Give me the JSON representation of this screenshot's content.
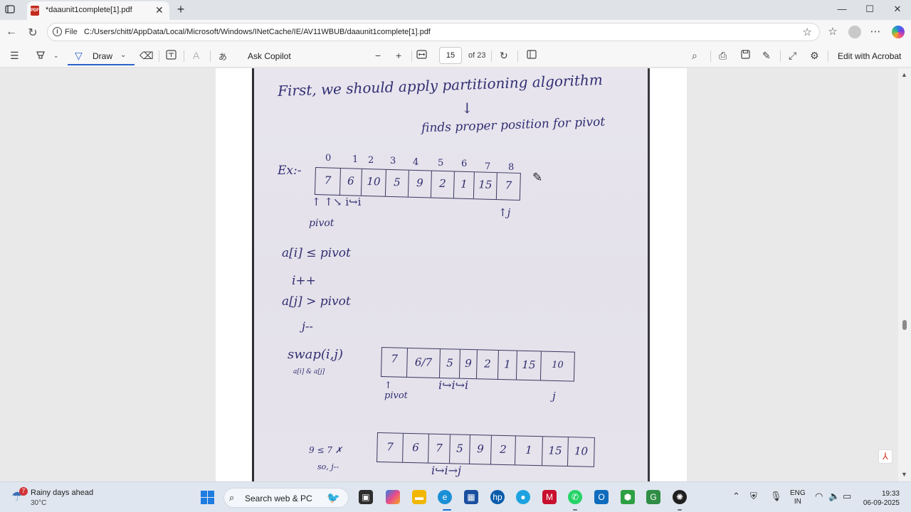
{
  "browser": {
    "tab_title": "*daaunit1complete[1].pdf",
    "new_tab": "+",
    "close_tab": "✕",
    "window_minimize": "—",
    "window_maximize": "☐",
    "window_close": "✕",
    "url_scheme_label": "File",
    "url_path": "C:/Users/chitt/AppData/Local/Microsoft/Windows/INetCache/IE/AV11WBUB/daaunit1complete[1].pdf"
  },
  "pdf_toolbar": {
    "draw_label": "Draw",
    "ask_copilot": "Ask Copilot",
    "zoom_out": "−",
    "zoom_in": "+",
    "page_number": "15",
    "page_total": "of 23",
    "edit_with_acrobat": "Edit with Acrobat"
  },
  "notes": {
    "line1": "First, we should apply partitioning algorithm",
    "arrow": "↓",
    "line2": "finds proper position for pivot",
    "ex_label": "Ex:-",
    "indices": [
      "0",
      "1",
      "2",
      "3",
      "4",
      "5",
      "6",
      "7",
      "8"
    ],
    "array1": [
      "7",
      "6",
      "10",
      "5",
      "9",
      "2",
      "1",
      "15",
      "7"
    ],
    "below_array1_left": "↑ ↑↘ i↪i",
    "pivot_label": "pivot",
    "j_label": "↑j",
    "rule1": "a[i] ≤ pivot",
    "rule2": "i++",
    "rule3": "a[j] > pivot",
    "rule4": "j--",
    "swap_label": "swap(i,j)",
    "swap_sub": "a[i] & a[j]",
    "array2": [
      "7",
      "6/7",
      "5",
      "9",
      "2",
      "1",
      "15",
      "10"
    ],
    "array2_marks": "i↪i↪i",
    "array2_pivot": "↑ pivot",
    "array2_j": "j",
    "compare_note1": "9 ≤ 7 ✗",
    "compare_note2": "so, j--",
    "array3": [
      "7",
      "6",
      "7",
      "5",
      "9",
      "2",
      "1",
      "15",
      "10"
    ],
    "array3_marks": "i↪i→j"
  },
  "taskbar": {
    "weather_badge": "7",
    "weather_title": "Rainy days ahead",
    "weather_temp": "30°C",
    "search_placeholder": "Search web & PC",
    "lang_top": "ENG",
    "lang_bottom": "IN",
    "time": "19:33",
    "date": "06-09-2025"
  },
  "colors": {
    "ink": "#312f72",
    "accent": "#2b63c9",
    "pdf_red": "#c42b1c"
  }
}
